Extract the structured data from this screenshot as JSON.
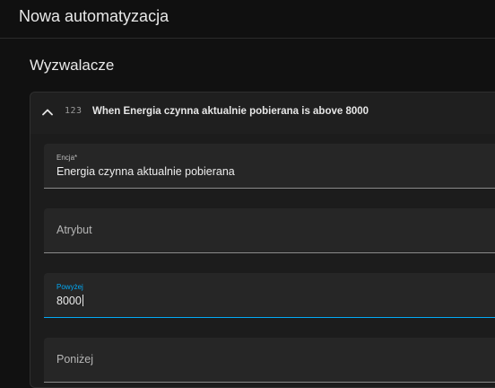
{
  "app": {
    "title": "Nowa automatyzacja"
  },
  "section": {
    "title": "Wyzwalacze"
  },
  "trigger": {
    "icon_text": "123",
    "summary": "When Energia czynna aktualnie pobierana is above 8000",
    "expanded": true,
    "chevron": "chevron-up-icon"
  },
  "fields": {
    "entity": {
      "label": "Encja*",
      "value": "Energia czynna aktualnie pobierana"
    },
    "attribute": {
      "placeholder": "Atrybut"
    },
    "above": {
      "label": "Powyżej",
      "value": "8000"
    },
    "below": {
      "placeholder": "Poniżej"
    }
  },
  "colors": {
    "accent": "#03a9f4",
    "background": "#111111",
    "card": "#1c1c1c",
    "field": "#262626"
  }
}
